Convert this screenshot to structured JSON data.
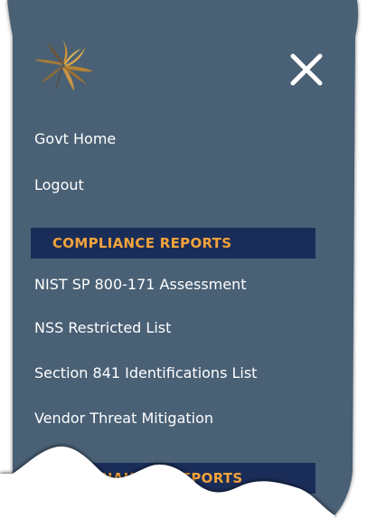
{
  "menu": {
    "items": [
      {
        "label": "Govt Home"
      },
      {
        "label": "Logout"
      }
    ]
  },
  "sections": [
    {
      "title": "COMPLIANCE REPORTS",
      "items": [
        {
          "label": "NIST SP 800-171 Assessment"
        },
        {
          "label": "NSS Restricted List"
        },
        {
          "label": "Section 841 Identifications List"
        },
        {
          "label": "Vendor Threat Mitigation"
        }
      ]
    },
    {
      "title": "ANALYSIS REPORTS"
    }
  ],
  "icons": {
    "logo": "starburst-logo-icon",
    "close": "close-icon"
  },
  "colors": {
    "panel_background": "#486175",
    "section_header_background": "#1a2d59",
    "section_header_text": "#f2a33b",
    "item_text": "#ffffff",
    "close_icon": "#ffffff"
  }
}
